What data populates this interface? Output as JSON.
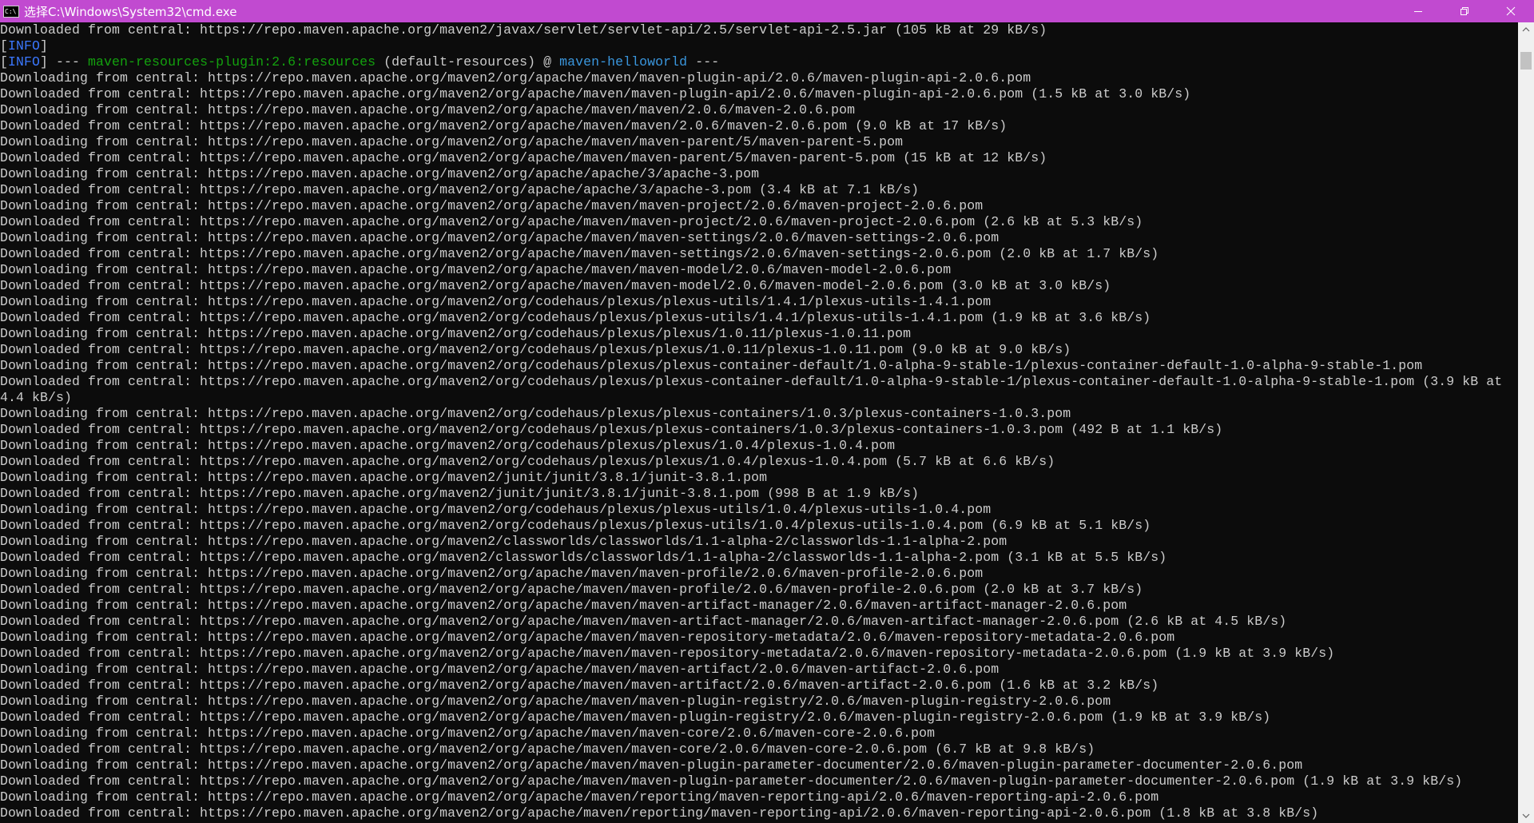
{
  "window": {
    "title": "选择C:\\Windows\\System32\\cmd.exe",
    "icon_text": "C:\\",
    "icon_name": "cmd-icon",
    "title_bar_color": "#c14ad0"
  },
  "scroll_position": 0.02,
  "console": {
    "info_tag": "INFO",
    "line0": "Downloaded from central: https://repo.maven.apache.org/maven2/javax/servlet/servlet-api/2.5/servlet-api-2.5.jar (105 kB at 29 kB/s)",
    "plugin_line": {
      "prefix": "] --- ",
      "plugin": "maven-resources-plugin:2.6:resources",
      "middle": " (default-resources) @ ",
      "project": "maven-helloworld",
      "suffix": " ---"
    },
    "lines": [
      "Downloading from central: https://repo.maven.apache.org/maven2/org/apache/maven/maven-plugin-api/2.0.6/maven-plugin-api-2.0.6.pom",
      "Downloaded from central: https://repo.maven.apache.org/maven2/org/apache/maven/maven-plugin-api/2.0.6/maven-plugin-api-2.0.6.pom (1.5 kB at 3.0 kB/s)",
      "Downloading from central: https://repo.maven.apache.org/maven2/org/apache/maven/maven/2.0.6/maven-2.0.6.pom",
      "Downloaded from central: https://repo.maven.apache.org/maven2/org/apache/maven/maven/2.0.6/maven-2.0.6.pom (9.0 kB at 17 kB/s)",
      "Downloading from central: https://repo.maven.apache.org/maven2/org/apache/maven/maven-parent/5/maven-parent-5.pom",
      "Downloaded from central: https://repo.maven.apache.org/maven2/org/apache/maven/maven-parent/5/maven-parent-5.pom (15 kB at 12 kB/s)",
      "Downloading from central: https://repo.maven.apache.org/maven2/org/apache/apache/3/apache-3.pom",
      "Downloaded from central: https://repo.maven.apache.org/maven2/org/apache/apache/3/apache-3.pom (3.4 kB at 7.1 kB/s)",
      "Downloading from central: https://repo.maven.apache.org/maven2/org/apache/maven/maven-project/2.0.6/maven-project-2.0.6.pom",
      "Downloaded from central: https://repo.maven.apache.org/maven2/org/apache/maven/maven-project/2.0.6/maven-project-2.0.6.pom (2.6 kB at 5.3 kB/s)",
      "Downloading from central: https://repo.maven.apache.org/maven2/org/apache/maven/maven-settings/2.0.6/maven-settings-2.0.6.pom",
      "Downloaded from central: https://repo.maven.apache.org/maven2/org/apache/maven/maven-settings/2.0.6/maven-settings-2.0.6.pom (2.0 kB at 1.7 kB/s)",
      "Downloading from central: https://repo.maven.apache.org/maven2/org/apache/maven/maven-model/2.0.6/maven-model-2.0.6.pom",
      "Downloaded from central: https://repo.maven.apache.org/maven2/org/apache/maven/maven-model/2.0.6/maven-model-2.0.6.pom (3.0 kB at 3.0 kB/s)",
      "Downloading from central: https://repo.maven.apache.org/maven2/org/codehaus/plexus/plexus-utils/1.4.1/plexus-utils-1.4.1.pom",
      "Downloaded from central: https://repo.maven.apache.org/maven2/org/codehaus/plexus/plexus-utils/1.4.1/plexus-utils-1.4.1.pom (1.9 kB at 3.6 kB/s)",
      "Downloading from central: https://repo.maven.apache.org/maven2/org/codehaus/plexus/plexus/1.0.11/plexus-1.0.11.pom",
      "Downloaded from central: https://repo.maven.apache.org/maven2/org/codehaus/plexus/plexus/1.0.11/plexus-1.0.11.pom (9.0 kB at 9.0 kB/s)",
      "Downloading from central: https://repo.maven.apache.org/maven2/org/codehaus/plexus/plexus-container-default/1.0-alpha-9-stable-1/plexus-container-default-1.0-alpha-9-stable-1.pom",
      "Downloaded from central: https://repo.maven.apache.org/maven2/org/codehaus/plexus/plexus-container-default/1.0-alpha-9-stable-1/plexus-container-default-1.0-alpha-9-stable-1.pom (3.9 kB at",
      "4.4 kB/s)",
      "Downloading from central: https://repo.maven.apache.org/maven2/org/codehaus/plexus/plexus-containers/1.0.3/plexus-containers-1.0.3.pom",
      "Downloaded from central: https://repo.maven.apache.org/maven2/org/codehaus/plexus/plexus-containers/1.0.3/plexus-containers-1.0.3.pom (492 B at 1.1 kB/s)",
      "Downloading from central: https://repo.maven.apache.org/maven2/org/codehaus/plexus/plexus/1.0.4/plexus-1.0.4.pom",
      "Downloaded from central: https://repo.maven.apache.org/maven2/org/codehaus/plexus/plexus/1.0.4/plexus-1.0.4.pom (5.7 kB at 6.6 kB/s)",
      "Downloading from central: https://repo.maven.apache.org/maven2/junit/junit/3.8.1/junit-3.8.1.pom",
      "Downloaded from central: https://repo.maven.apache.org/maven2/junit/junit/3.8.1/junit-3.8.1.pom (998 B at 1.9 kB/s)",
      "Downloading from central: https://repo.maven.apache.org/maven2/org/codehaus/plexus/plexus-utils/1.0.4/plexus-utils-1.0.4.pom",
      "Downloaded from central: https://repo.maven.apache.org/maven2/org/codehaus/plexus/plexus-utils/1.0.4/plexus-utils-1.0.4.pom (6.9 kB at 5.1 kB/s)",
      "Downloading from central: https://repo.maven.apache.org/maven2/classworlds/classworlds/1.1-alpha-2/classworlds-1.1-alpha-2.pom",
      "Downloaded from central: https://repo.maven.apache.org/maven2/classworlds/classworlds/1.1-alpha-2/classworlds-1.1-alpha-2.pom (3.1 kB at 5.5 kB/s)",
      "Downloading from central: https://repo.maven.apache.org/maven2/org/apache/maven/maven-profile/2.0.6/maven-profile-2.0.6.pom",
      "Downloaded from central: https://repo.maven.apache.org/maven2/org/apache/maven/maven-profile/2.0.6/maven-profile-2.0.6.pom (2.0 kB at 3.7 kB/s)",
      "Downloading from central: https://repo.maven.apache.org/maven2/org/apache/maven/maven-artifact-manager/2.0.6/maven-artifact-manager-2.0.6.pom",
      "Downloaded from central: https://repo.maven.apache.org/maven2/org/apache/maven/maven-artifact-manager/2.0.6/maven-artifact-manager-2.0.6.pom (2.6 kB at 4.5 kB/s)",
      "Downloading from central: https://repo.maven.apache.org/maven2/org/apache/maven/maven-repository-metadata/2.0.6/maven-repository-metadata-2.0.6.pom",
      "Downloaded from central: https://repo.maven.apache.org/maven2/org/apache/maven/maven-repository-metadata/2.0.6/maven-repository-metadata-2.0.6.pom (1.9 kB at 3.9 kB/s)",
      "Downloading from central: https://repo.maven.apache.org/maven2/org/apache/maven/maven-artifact/2.0.6/maven-artifact-2.0.6.pom",
      "Downloaded from central: https://repo.maven.apache.org/maven2/org/apache/maven/maven-artifact/2.0.6/maven-artifact-2.0.6.pom (1.6 kB at 3.2 kB/s)",
      "Downloading from central: https://repo.maven.apache.org/maven2/org/apache/maven/maven-plugin-registry/2.0.6/maven-plugin-registry-2.0.6.pom",
      "Downloaded from central: https://repo.maven.apache.org/maven2/org/apache/maven/maven-plugin-registry/2.0.6/maven-plugin-registry-2.0.6.pom (1.9 kB at 3.9 kB/s)",
      "Downloading from central: https://repo.maven.apache.org/maven2/org/apache/maven/maven-core/2.0.6/maven-core-2.0.6.pom",
      "Downloaded from central: https://repo.maven.apache.org/maven2/org/apache/maven/maven-core/2.0.6/maven-core-2.0.6.pom (6.7 kB at 9.8 kB/s)",
      "Downloading from central: https://repo.maven.apache.org/maven2/org/apache/maven/maven-plugin-parameter-documenter/2.0.6/maven-plugin-parameter-documenter-2.0.6.pom",
      "Downloaded from central: https://repo.maven.apache.org/maven2/org/apache/maven/maven-plugin-parameter-documenter/2.0.6/maven-plugin-parameter-documenter-2.0.6.pom (1.9 kB at 3.9 kB/s)",
      "Downloading from central: https://repo.maven.apache.org/maven2/org/apache/maven/reporting/maven-reporting-api/2.0.6/maven-reporting-api-2.0.6.pom",
      "Downloaded from central: https://repo.maven.apache.org/maven2/org/apache/maven/reporting/maven-reporting-api/2.0.6/maven-reporting-api-2.0.6.pom (1.8 kB at 3.8 kB/s)"
    ]
  }
}
